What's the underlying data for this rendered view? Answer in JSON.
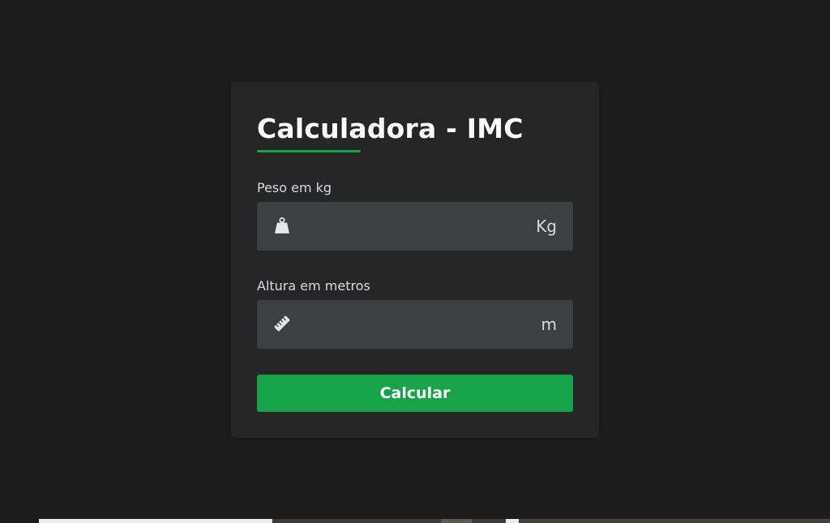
{
  "card": {
    "title": "Calculadora - IMC"
  },
  "weight": {
    "label": "Peso em kg",
    "value": "",
    "placeholder": "",
    "unit": "Kg",
    "icon": "weight-icon"
  },
  "height": {
    "label": "Altura em metros",
    "value": "",
    "placeholder": "",
    "unit": "m",
    "icon": "ruler-icon"
  },
  "actions": {
    "calculate_label": "Calcular"
  },
  "colors": {
    "background": "#1b1b1c",
    "card": "#262627",
    "input": "#3e3f45",
    "accent": "#16a34a",
    "label": "#d8dae0"
  }
}
